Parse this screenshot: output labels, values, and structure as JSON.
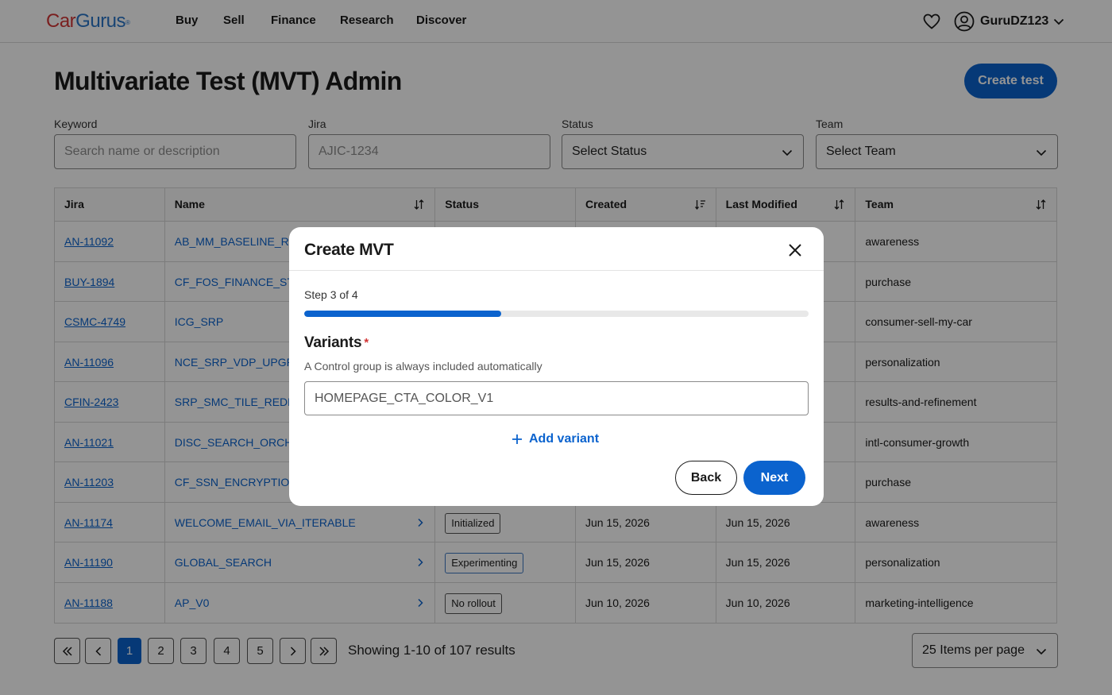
{
  "brand": {
    "logo_part1": "Car",
    "logo_part2": "Gurus",
    "logo_mark": "®"
  },
  "nav": {
    "items": [
      "Buy",
      "Sell",
      "Finance",
      "Research",
      "Discover"
    ],
    "username": "GuruDZ123"
  },
  "page": {
    "title": "Multivariate Test (MVT) Admin",
    "create_button": "Create test"
  },
  "filters": {
    "keyword_label": "Keyword",
    "keyword_placeholder": "Search name or description",
    "jira_label": "Jira",
    "jira_placeholder": "AJIC-1234",
    "status_label": "Status",
    "status_value": "Select Status",
    "team_label": "Team",
    "team_value": "Select Team"
  },
  "table": {
    "columns": [
      "Jira",
      "Name",
      "Status",
      "Created",
      "Last Modified",
      "Team"
    ],
    "rows": [
      {
        "jira": "AN-11092",
        "name": "AB_MM_BASELINE_RES",
        "status": "",
        "created": "",
        "modified": "",
        "team": "awareness"
      },
      {
        "jira": "BUY-1894",
        "name": "CF_FOS_FINANCE_STR",
        "status": "",
        "created": "",
        "modified": "",
        "team": "purchase"
      },
      {
        "jira": "CSMC-4749",
        "name": "ICG_SRP",
        "status": "",
        "created": "",
        "modified": "",
        "team": "consumer-sell-my-car"
      },
      {
        "jira": "AN-11096",
        "name": "NCE_SRP_VDP_UPGRA",
        "status": "",
        "created": "",
        "modified": "",
        "team": "personalization"
      },
      {
        "jira": "CFIN-2423",
        "name": "SRP_SMC_TILE_REDES",
        "status": "",
        "created": "",
        "modified": "",
        "team": "results-and-refinement"
      },
      {
        "jira": "AN-11021",
        "name": "DISC_SEARCH_ORCH",
        "status": "",
        "created": "",
        "modified": "",
        "team": "intl-consumer-growth"
      },
      {
        "jira": "AN-11203",
        "name": "CF_SSN_ENCRYPTION",
        "status": "",
        "created": "",
        "modified": "",
        "team": "purchase"
      },
      {
        "jira": "AN-11174",
        "name": "WELCOME_EMAIL_VIA_ITERABLE",
        "status": "Initialized",
        "created": "Jun 15, 2026",
        "modified": "Jun 15, 2026",
        "team": "awareness"
      },
      {
        "jira": "AN-11190",
        "name": "GLOBAL_SEARCH",
        "status": "Experimenting",
        "created": "Jun 15, 2026",
        "modified": "Jun 15, 2026",
        "team": "personalization"
      },
      {
        "jira": "AN-11188",
        "name": "AP_V0",
        "status": "No rollout",
        "created": "Jun 10, 2026",
        "modified": "Jun 10, 2026",
        "team": "marketing-intelligence"
      }
    ]
  },
  "pagination": {
    "pages": [
      "1",
      "2",
      "3",
      "4",
      "5"
    ],
    "current_page": "1",
    "results_text": "Showing 1-10 of 107 results",
    "per_page_value": "25 Items per page"
  },
  "modal": {
    "title": "Create MVT",
    "step_text": "Step 3 of 4",
    "progress_fraction": 0.39,
    "variants_heading": "Variants",
    "required_mark": "*",
    "helper_text": "A Control group is always included automatically",
    "variant_value": "HOMEPAGE_CTA_COLOR_V1",
    "add_variant_label": "Add variant",
    "back_label": "Back",
    "next_label": "Next"
  },
  "colors": {
    "primary": "#0b63ce",
    "logo_red": "#d23636",
    "logo_blue": "#2a76c8",
    "required": "#d23636"
  },
  "icons": [
    "heart-icon",
    "user-icon",
    "chevron-down-icon",
    "sort-icon",
    "chevron-right-icon",
    "close-icon",
    "plus-icon",
    "double-chevron-left-icon",
    "double-chevron-right-icon"
  ]
}
